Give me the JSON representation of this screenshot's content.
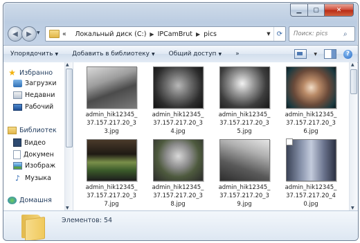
{
  "address": {
    "crumb_prefix": "«",
    "crumbs": [
      "Локальный диск (C:)",
      "IPCamBrut",
      "pics"
    ]
  },
  "search": {
    "placeholder": "Поиск: pics"
  },
  "toolbar": {
    "organize": "Упорядочить",
    "add_to_library": "Добавить в библиотеку",
    "share": "Общий доступ",
    "more": "»"
  },
  "navpane": {
    "favorites": "Избранно",
    "downloads": "Загрузки",
    "recent": "Недавни",
    "desktop": "Рабочий",
    "libraries": "Библиотек",
    "video": "Видео",
    "documents": "Докумен",
    "images": "Изображ",
    "music": "Музыка",
    "homegroup": "Домашня"
  },
  "files": [
    {
      "name": "admin_hik12345_37.157.217.20_33.jpg"
    },
    {
      "name": "admin_hik12345_37.157.217.20_34.jpg"
    },
    {
      "name": "admin_hik12345_37.157.217.20_35.jpg"
    },
    {
      "name": "admin_hik12345_37.157.217.20_36.jpg"
    },
    {
      "name": "admin_hik12345_37.157.217.20_37.jpg"
    },
    {
      "name": "admin_hik12345_37.157.217.20_38.jpg"
    },
    {
      "name": "admin_hik12345_37.157.217.20_39.jpg"
    },
    {
      "name": "admin_hik12345_37.157.217.20_40.jpg"
    }
  ],
  "status": {
    "count_text": "Элементов: 54"
  }
}
